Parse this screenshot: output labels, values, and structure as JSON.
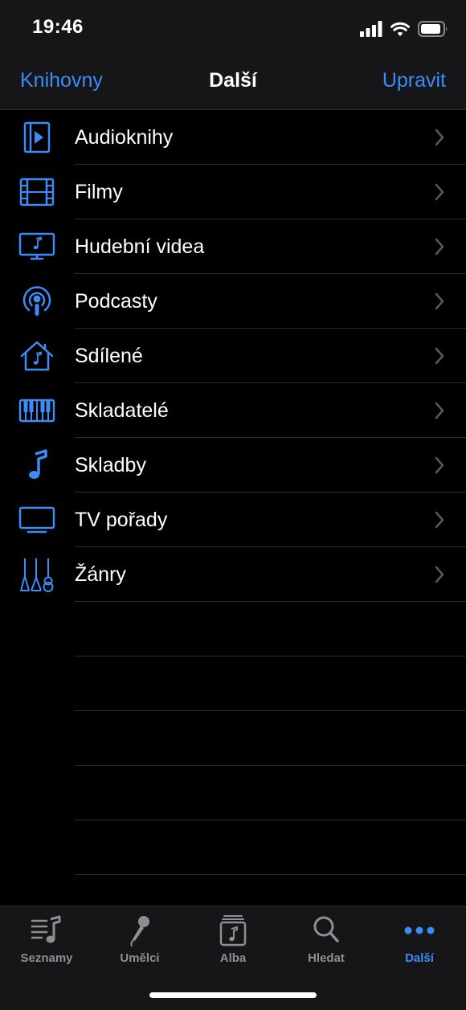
{
  "status": {
    "time": "19:46"
  },
  "nav": {
    "back_label": "Knihovny",
    "title": "Další",
    "edit_label": "Upravit"
  },
  "list": {
    "items": [
      {
        "label": "Audioknihy",
        "icon": "audiobook-icon"
      },
      {
        "label": "Filmy",
        "icon": "film-icon"
      },
      {
        "label": "Hudební videa",
        "icon": "music-video-icon"
      },
      {
        "label": "Podcasty",
        "icon": "podcast-icon"
      },
      {
        "label": "Sdílené",
        "icon": "home-sharing-icon"
      },
      {
        "label": "Skladatelé",
        "icon": "piano-icon"
      },
      {
        "label": "Skladby",
        "icon": "music-note-icon"
      },
      {
        "label": "TV pořady",
        "icon": "tv-icon"
      },
      {
        "label": "Žánry",
        "icon": "guitars-icon"
      }
    ]
  },
  "tabs": [
    {
      "label": "Seznamy",
      "icon": "playlist-icon",
      "active": false
    },
    {
      "label": "Umělci",
      "icon": "microphone-icon",
      "active": false
    },
    {
      "label": "Alba",
      "icon": "album-icon",
      "active": false
    },
    {
      "label": "Hledat",
      "icon": "search-icon",
      "active": false
    },
    {
      "label": "Další",
      "icon": "more-icon",
      "active": true
    }
  ],
  "colors": {
    "accent": "#3c8cf7",
    "inactive": "#8e8e93",
    "bar_bg": "#161618",
    "background": "#000000"
  }
}
